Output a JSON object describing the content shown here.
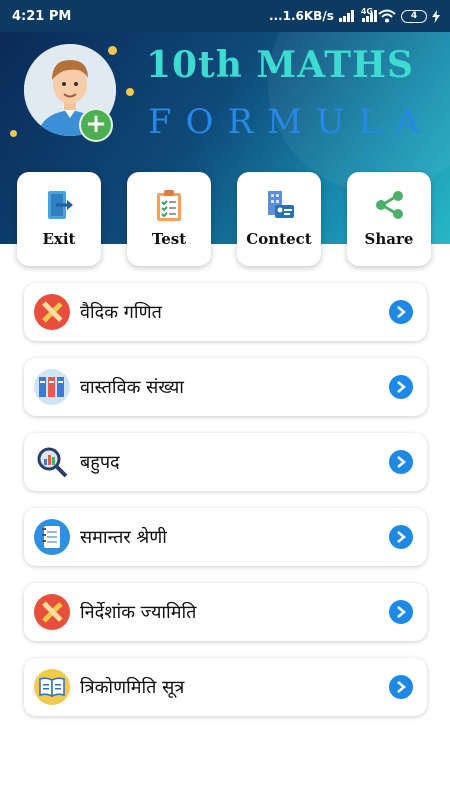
{
  "status_bar": {
    "time": "4:21 PM",
    "speed": "...1.6KB/s",
    "network": "4G",
    "battery": "4"
  },
  "header": {
    "title_line1": "10th MATHS",
    "title_line2": "FORMULA"
  },
  "quick_actions": [
    {
      "label": "Exit",
      "icon": "exit-icon"
    },
    {
      "label": "Test",
      "icon": "clipboard-checklist-icon"
    },
    {
      "label": "Contect",
      "icon": "contact-card-icon"
    },
    {
      "label": "Share",
      "icon": "share-icon"
    }
  ],
  "topics": [
    {
      "label": "वैदिक गणित",
      "icon": "pencil-ruler-icon"
    },
    {
      "label": "वास्तविक संख्या",
      "icon": "books-icon"
    },
    {
      "label": "बहुपद",
      "icon": "magnifier-chart-icon"
    },
    {
      "label": "समान्तर श्रेणी",
      "icon": "notepad-icon"
    },
    {
      "label": "निर्देशांक ज्यामिति",
      "icon": "pencil-ruler-icon"
    },
    {
      "label": "त्रिकोणमिति सूत्र",
      "icon": "open-book-icon"
    }
  ],
  "colors": {
    "status_bar": "#0d3a63",
    "header_start": "#0b2a57",
    "header_end": "#28b8c6",
    "title_line1": "#3ddbd0",
    "title_line2": "#2788e6",
    "chevron": "#1e88e5",
    "add_badge": "#4caf50"
  }
}
